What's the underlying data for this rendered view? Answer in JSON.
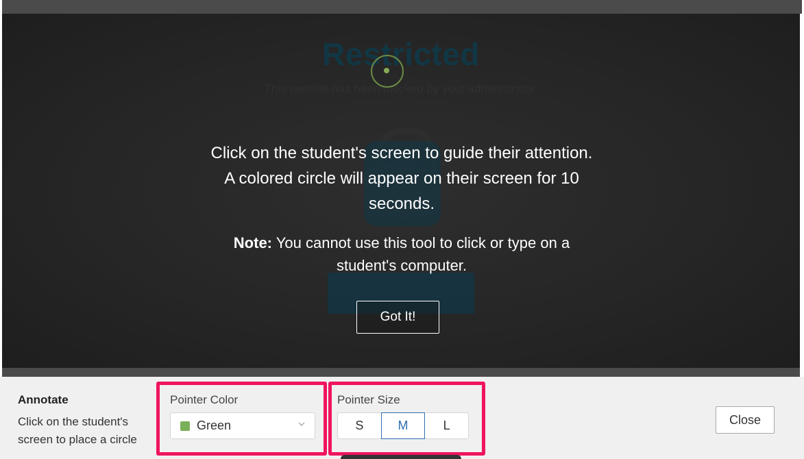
{
  "remote_screen": {
    "page_title": "Restricted",
    "page_subtitle": "This website has been blocked by your administrator."
  },
  "overlay": {
    "message": "Click on the student's screen to guide their attention. A colored circle will appear on their screen for 10 seconds.",
    "note_label": "Note:",
    "note_text": " You cannot use this tool to click or type on a student's computer.",
    "got_it_label": "Got It!"
  },
  "pointer": {
    "icon": "pointer-circle-icon",
    "color": "#88aa55"
  },
  "panel": {
    "title": "Annotate",
    "description": "Click on the student's screen to place a circle",
    "pointer_color_label": "Pointer Color",
    "pointer_color_value": "Green",
    "pointer_color_swatch": "#7bb05a",
    "pointer_size_label": "Pointer Size",
    "sizes": [
      "S",
      "M",
      "L"
    ],
    "selected_size": "M",
    "close_label": "Close"
  },
  "colors": {
    "highlight": "#f0145e",
    "accent": "#2f6fb0"
  }
}
